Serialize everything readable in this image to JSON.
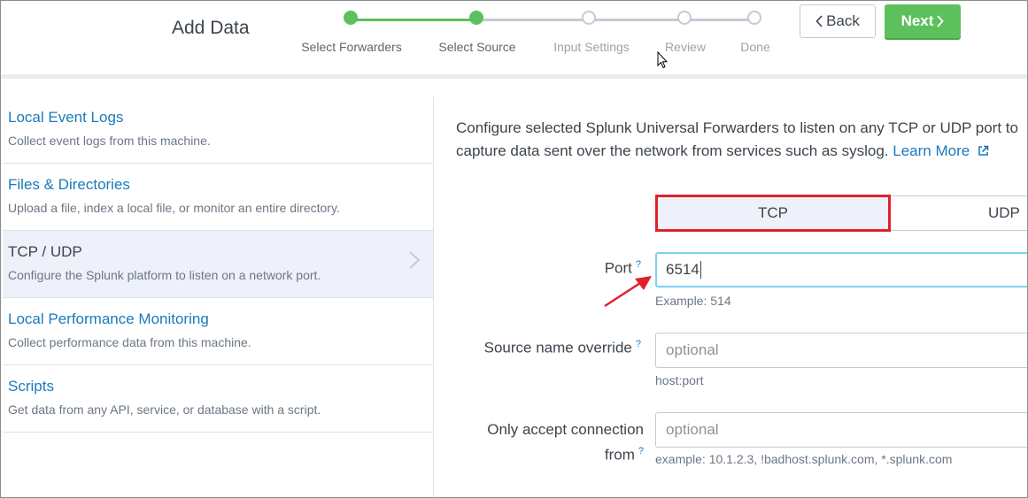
{
  "header": {
    "title": "Add Data",
    "steps": [
      {
        "label": "Select Forwarders",
        "state": "done"
      },
      {
        "label": "Select Source",
        "state": "done"
      },
      {
        "label": "Input Settings",
        "state": "todo"
      },
      {
        "label": "Review",
        "state": "todo"
      },
      {
        "label": "Done",
        "state": "todo"
      }
    ],
    "back_label": "Back",
    "next_label": "Next"
  },
  "sources": [
    {
      "title": "Local Event Logs",
      "desc": "Collect event logs from this machine."
    },
    {
      "title": "Files & Directories",
      "desc": "Upload a file, index a local file, or monitor an entire directory."
    },
    {
      "title": "TCP / UDP",
      "desc": "Configure the Splunk platform to listen on a network port."
    },
    {
      "title": "Local Performance Monitoring",
      "desc": "Collect performance data from this machine."
    },
    {
      "title": "Scripts",
      "desc": "Get data from any API, service, or database with a script."
    }
  ],
  "main": {
    "description": "Configure selected Splunk Universal Forwarders to listen on any TCP or UDP port to capture data sent over the network from services such as syslog.",
    "learn_more": "Learn More",
    "protocol": {
      "tcp": "TCP",
      "udp": "UDP",
      "selected": "TCP"
    },
    "help_mark": "?",
    "port": {
      "label": "Port",
      "value": "6514",
      "help": "Example: 514"
    },
    "source_name": {
      "label": "Source name override",
      "placeholder": "optional",
      "help": "host:port"
    },
    "accept_from": {
      "label_line1": "Only accept connection",
      "label_line2": "from",
      "placeholder": "optional",
      "help": "example: 10.1.2.3, !badhost.splunk.com, *.splunk.com"
    }
  },
  "colors": {
    "accent_green": "#5cc05c",
    "link_blue": "#1a7bbc",
    "highlight_red": "#e2202c",
    "focus_blue": "#7fd0ef"
  }
}
